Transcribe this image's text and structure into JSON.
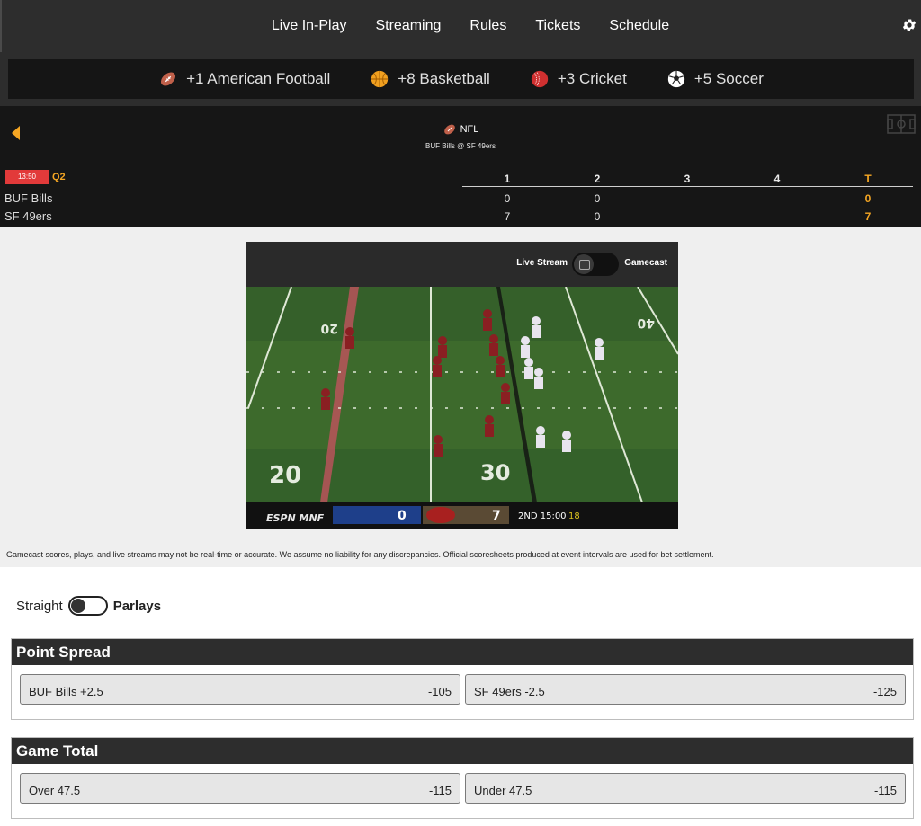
{
  "nav": {
    "links": [
      "Live In-Play",
      "Streaming",
      "Rules",
      "Tickets",
      "Schedule"
    ],
    "settings_icon": "gear-icon"
  },
  "sports": [
    {
      "label": "+1 American Football",
      "icon": "football-icon"
    },
    {
      "label": "+8 Basketball",
      "icon": "basketball-icon"
    },
    {
      "label": "+3 Cricket",
      "icon": "cricket-ball-icon"
    },
    {
      "label": "+5 Soccer",
      "icon": "soccer-ball-icon"
    }
  ],
  "scoreboard": {
    "league": "NFL",
    "matchup": "BUF Bills @ SF 49ers",
    "clock": "13:50",
    "quarter": "Q2",
    "headers": [
      "1",
      "2",
      "3",
      "4",
      "T"
    ],
    "teams": [
      {
        "name": "BUF Bills",
        "q1": "0",
        "q2": "0",
        "q3": "",
        "q4": "",
        "total": "0"
      },
      {
        "name": "SF 49ers",
        "q1": "7",
        "q2": "0",
        "q3": "",
        "q4": "",
        "total": "7"
      }
    ]
  },
  "player": {
    "live_stream_label": "Live Stream",
    "gamecast_label": "Gamecast",
    "broadcast": {
      "network": "ESPN MNF",
      "away_score": "0",
      "home_score": "7",
      "status": "2ND 15:00",
      "down": "18",
      "yard_left": "20",
      "yard_mid": "30",
      "yard_top_left": "20",
      "yard_top_right": "40"
    }
  },
  "disclaimer": "Gamecast scores, plays, and live streams may not be real-time or accurate. We assume no liability for any discrepancies. Official scoresheets produced at event intervals are used for bet settlement.",
  "wager_mode": {
    "left": "Straight",
    "right": "Parlays"
  },
  "markets": [
    {
      "title": "Point Spread",
      "options": [
        {
          "label": "BUF Bills +2.5",
          "price": "-105"
        },
        {
          "label": "SF 49ers -2.5",
          "price": "-125"
        }
      ]
    },
    {
      "title": "Game Total",
      "options": [
        {
          "label": "Over 47.5",
          "price": "-115"
        },
        {
          "label": "Under 47.5",
          "price": "-115"
        }
      ]
    }
  ],
  "colors": {
    "accent": "#f5a623",
    "clock_bg": "#e23a3a",
    "header_bg": "#2d2d2d"
  }
}
